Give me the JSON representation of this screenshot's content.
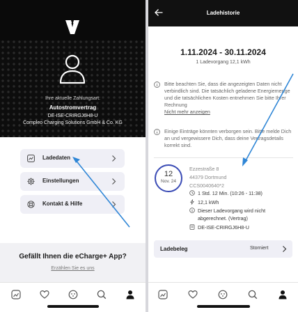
{
  "left_screen": {
    "contract_label": "Ihre aktuelle Zahlungsart:",
    "contract_name": "Autostromvertrag",
    "contract_id": "DE-ISE-CRIRGJ6H8-U",
    "company": "Compleo Charging Solutions GmbH & Co. KG",
    "menu": [
      {
        "label": "Ladedaten",
        "icon": "chart-line-icon"
      },
      {
        "label": "Einstellungen",
        "icon": "gear-icon"
      },
      {
        "label": "Kontakt & Hilfe",
        "icon": "lifebuoy-icon"
      }
    ],
    "feedback_title": "Gefällt Ihnen die eCharge+ App?",
    "feedback_link": "Erzählen Sie es uns",
    "tabbar": [
      "map-icon",
      "heart-icon",
      "charger-icon",
      "search-icon",
      "user-icon"
    ],
    "arrow_color": "#2f86d6"
  },
  "right_screen": {
    "title": "Ladehistorie",
    "period": "1.11.2024 - 30.11.2024",
    "session_count": "1 Ladevorgang 12,1 kWh",
    "notice_1": "Bitte beachten Sie, dass die angezeigten Daten nicht verbindlich sind. Die tatsächlich geladene Energiemenge und die tatsächlichen Kosten entnehmen Sie bitte Ihrer Rechnung",
    "notice_1_link": "Nicht mehr anzeigen",
    "notice_2": "Einige Einträge könnten verborgen sein. Bitte melde Dich an und vergewissere Dich, dass deine Vertragsdetails korrekt sind.",
    "session": {
      "day": "12",
      "month": "Nov. 24",
      "street": "Ezzestraße 8",
      "city": "44379 Dortmund",
      "station_id": "CCS0040640*2",
      "duration": "1 Std. 12 Min. (10:26 - 11:38)",
      "energy": "12,1 kWh",
      "status_line1": "Dieser Ladevorgang wird nicht",
      "status_line2": "abgerechnet. (Vertrag)",
      "contract_id": "DE-ISE-CRIRGJ6H8-U"
    },
    "receipt_label": "Ladebeleg",
    "receipt_status": "Storniert",
    "tabbar": [
      "map-icon",
      "heart-icon",
      "charger-icon",
      "search-icon",
      "user-icon"
    ],
    "accent_color": "#3a4bb5"
  }
}
